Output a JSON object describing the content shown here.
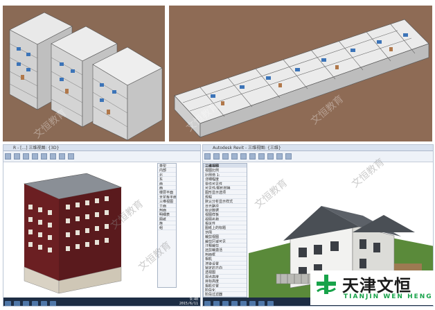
{
  "panels": {
    "top_left": {
      "caption": ""
    },
    "top_right": {
      "caption": ""
    },
    "bottom_left": {
      "window_title": "R - [...] 三维视图: {3D}",
      "clock_time": "9:40",
      "clock_date": "2015/6/11",
      "tree_items": [
        "类型",
        "内部",
        "北",
        "东",
        "南",
        "西",
        "楼层平面",
        "天花板平面",
        "三维视图",
        "立面",
        "剖面",
        "明细表",
        "图纸",
        "族",
        "组"
      ]
    },
    "bottom_right": {
      "window_title": "Autodesk Revit - 三维视图: {三维}",
      "props_header": "三维视图",
      "props_rows": [
        "视图比例",
        "比例值 1:",
        "详细程度",
        "零件可见性",
        "可见性/图形替换",
        "图形显示选项",
        "规程",
        "默认分析显示样式",
        "日光路径",
        "标识数据",
        "视图样板",
        "视图名称",
        "相关性",
        "图纸上的标题",
        "范围",
        "裁剪视图",
        "裁剪区域可见",
        "注释裁剪",
        "远剪裁激活",
        "剖面框",
        "相机",
        "渲染设置",
        "锁定的方向",
        "透视图",
        "视点高度",
        "目标高度",
        "相机位置",
        "阶段化",
        "阶段过滤器",
        "相位"
      ]
    }
  },
  "brand": {
    "name_cn": "天津文恒",
    "name_en": "TIANJIN WEN HENG"
  },
  "watermark": {
    "text": "文恒教育"
  },
  "colors": {
    "bg_brown": "#8a6a55",
    "brick": "#6b1f22",
    "grass": "#5a8a3a",
    "brand_green": "#18a34a"
  }
}
